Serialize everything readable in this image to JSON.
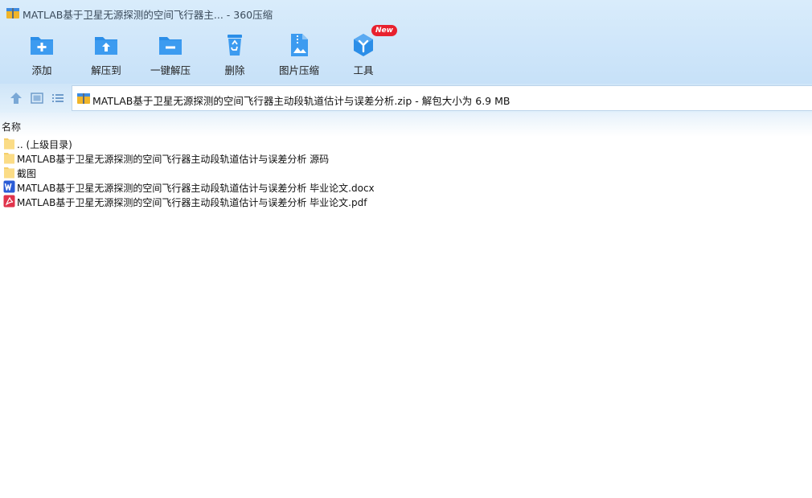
{
  "window": {
    "title": "MATLAB基于卫星无源探测的空间飞行器主... - 360压缩"
  },
  "toolbar": {
    "items": [
      {
        "label": "添加",
        "icon": "add-folder-icon"
      },
      {
        "label": "解压到",
        "icon": "extract-to-icon"
      },
      {
        "label": "一键解压",
        "icon": "one-click-extract-icon"
      },
      {
        "label": "删除",
        "icon": "delete-icon"
      },
      {
        "label": "图片压缩",
        "icon": "image-compress-icon"
      },
      {
        "label": "工具",
        "icon": "tools-icon",
        "badge": "New"
      }
    ]
  },
  "address": {
    "text": "MATLAB基于卫星无源探测的空间飞行器主动段轨道估计与误差分析.zip - 解包大小为 6.9 MB"
  },
  "list": {
    "column_header": "名称",
    "rows": [
      {
        "name": ".. (上级目录)",
        "type": "folder"
      },
      {
        "name": "MATLAB基于卫星无源探测的空间飞行器主动段轨道估计与误差分析 源码",
        "type": "folder"
      },
      {
        "name": "截图",
        "type": "folder"
      },
      {
        "name": "MATLAB基于卫星无源探测的空间飞行器主动段轨道估计与误差分析 毕业论文.docx",
        "type": "docx"
      },
      {
        "name": "MATLAB基于卫星无源探测的空间飞行器主动段轨道估计与误差分析 毕业论文.pdf",
        "type": "pdf"
      }
    ]
  },
  "colors": {
    "accent": "#2b8ee8",
    "folder": "#f8d776",
    "word": "#2b5cd6",
    "pdf": "#e0334b",
    "badge": "#e8212e"
  }
}
